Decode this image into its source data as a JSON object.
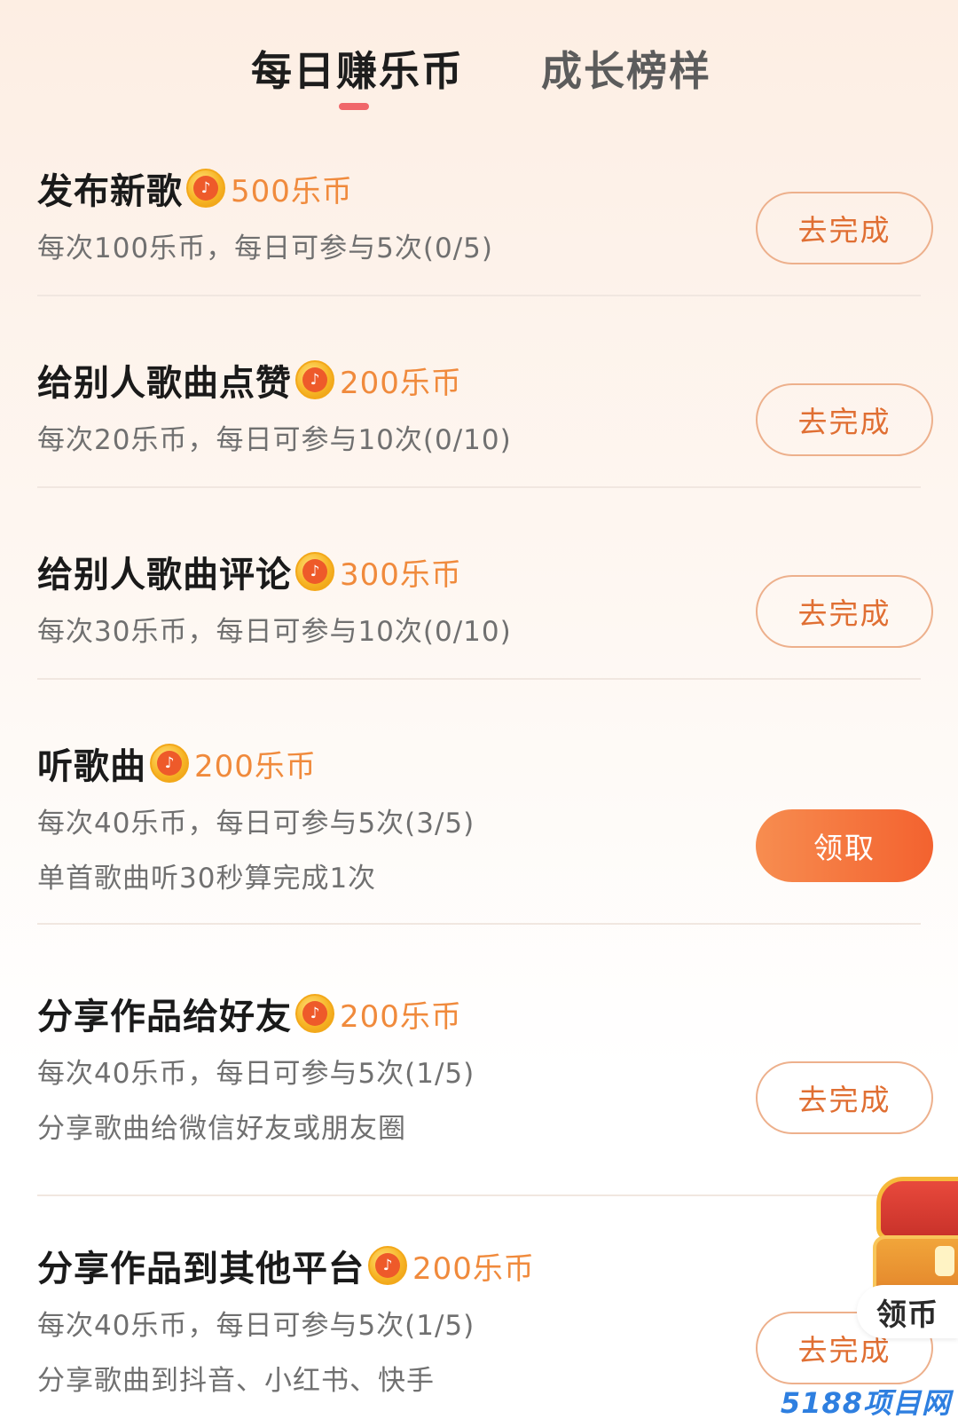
{
  "tabs": [
    {
      "label": "每日赚乐币",
      "active": true
    },
    {
      "label": "成长榜样",
      "active": false
    }
  ],
  "coin_icon_glyph": "♪",
  "tasks": [
    {
      "title": "发布新歌",
      "reward": "500乐币",
      "desc1": "每次100乐币，每日可参与5次(0/5)",
      "desc2": "",
      "button": "去完成",
      "button_style": "outline"
    },
    {
      "title": "给别人歌曲点赞",
      "reward": "200乐币",
      "desc1": "每次20乐币，每日可参与10次(0/10)",
      "desc2": "",
      "button": "去完成",
      "button_style": "outline"
    },
    {
      "title": "给别人歌曲评论",
      "reward": "300乐币",
      "desc1": "每次30乐币，每日可参与10次(0/10)",
      "desc2": "",
      "button": "去完成",
      "button_style": "outline"
    },
    {
      "title": "听歌曲",
      "reward": "200乐币",
      "desc1": "每次40乐币，每日可参与5次(3/5)",
      "desc2": "单首歌曲听30秒算完成1次",
      "button": "领取",
      "button_style": "filled"
    },
    {
      "title": "分享作品给好友",
      "reward": "200乐币",
      "desc1": "每次40乐币，每日可参与5次(1/5)",
      "desc2": "分享歌曲给微信好友或朋友圈",
      "button": "去完成",
      "button_style": "outline"
    },
    {
      "title": "分享作品到其他平台",
      "reward": "200乐币",
      "desc1": "每次40乐币，每日可参与5次(1/5)",
      "desc2": "分享歌曲到抖音、小红书、快手",
      "button": "去完成",
      "button_style": "outline"
    }
  ],
  "floating_widget": {
    "label": "领币"
  },
  "watermark": "5188项目网",
  "colors": {
    "accent_orange": "#f08a3c",
    "button_text": "#e06f33",
    "button_border": "#edb08c",
    "tab_indicator": "#f0676a"
  }
}
